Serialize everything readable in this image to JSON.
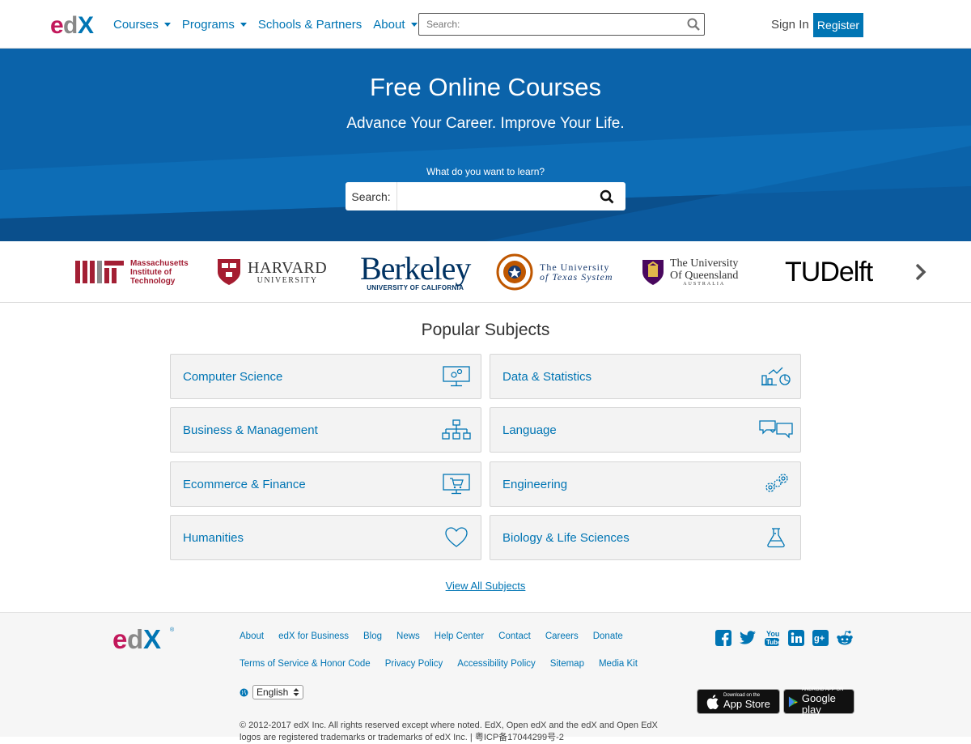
{
  "header": {
    "logo_text": "edX",
    "nav": [
      {
        "label": "Courses",
        "dropdown": true
      },
      {
        "label": "Programs",
        "dropdown": true
      },
      {
        "label": "Schools & Partners",
        "dropdown": false
      },
      {
        "label": "About",
        "dropdown": true
      }
    ],
    "search_placeholder": "Search:",
    "sign_in": "Sign In",
    "register": "Register"
  },
  "hero": {
    "title": "Free Online Courses",
    "subtitle": "Advance Your Career. Improve Your Life.",
    "question": "What do you want to learn?",
    "search_label": "Search:"
  },
  "partners": {
    "mit": [
      "Massachusetts",
      "Institute of",
      "Technology"
    ],
    "harvard": [
      "HARVARD",
      "UNIVERSITY"
    ],
    "berkeley": [
      "Berkeley",
      "UNIVERSITY OF CALIFORNIA"
    ],
    "texas": [
      "The University",
      "of Texas System"
    ],
    "queensland": [
      "The University",
      "Of Queensland",
      "AUSTRALIA"
    ],
    "tudelft": "TUDelft"
  },
  "subjects": {
    "title": "Popular Subjects",
    "items": [
      {
        "label": "Computer Science",
        "icon": "monitor-gears-icon"
      },
      {
        "label": "Data & Statistics",
        "icon": "chart-icon"
      },
      {
        "label": "Business & Management",
        "icon": "org-chart-icon"
      },
      {
        "label": "Language",
        "icon": "speech-bubbles-icon"
      },
      {
        "label": "Ecommerce & Finance",
        "icon": "cart-screen-icon"
      },
      {
        "label": "Engineering",
        "icon": "gears-icon"
      },
      {
        "label": "Humanities",
        "icon": "heart-icon"
      },
      {
        "label": "Biology & Life Sciences",
        "icon": "flask-icon"
      }
    ],
    "view_all": "View All Subjects"
  },
  "footer": {
    "row1": [
      "About",
      "edX for Business",
      "Blog",
      "News",
      "Help Center",
      "Contact",
      "Careers",
      "Donate"
    ],
    "row2": [
      "Terms of Service & Honor Code",
      "Privacy Policy",
      "Accessibility Policy",
      "Sitemap",
      "Media Kit"
    ],
    "language": "English",
    "app_store_small": "Download on the",
    "app_store_big": "App Store",
    "google_small": "ANDROID APP ON",
    "google_big": "Google play",
    "copyright": "© 2012-2017 edX Inc. All rights reserved except where noted. EdX, Open edX and the edX and Open EdX logos are registered trademarks or trademarks of edX Inc. | 粤ICP备17044299号-2"
  },
  "colors": {
    "brand_blue": "#0075b4",
    "hero_blue": "#0c5c9e",
    "edx_pink": "#c2185b"
  }
}
